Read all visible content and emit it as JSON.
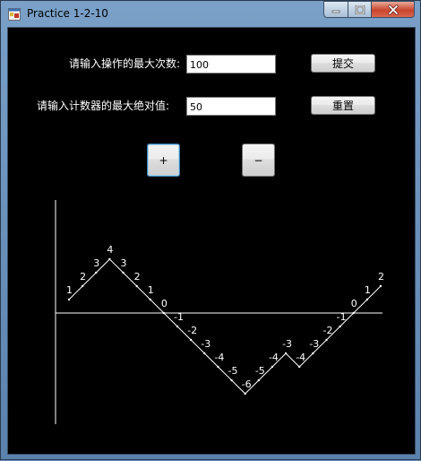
{
  "window": {
    "title": "Practice 1-2-10"
  },
  "form": {
    "max_ops_label": "请输入操作的最大次数:",
    "max_ops_value": "100",
    "max_abs_label": "请输入计数器的最大绝对值:",
    "max_abs_value": "50",
    "submit_label": "提交",
    "reset_label": "重置",
    "plus_label": "+",
    "minus_label": "−"
  },
  "graph": {
    "counter_values": [
      1,
      2,
      3,
      4,
      3,
      2,
      1,
      0,
      -1,
      -2,
      -3,
      -4,
      -5,
      -6,
      -5,
      -4,
      -3,
      -4,
      -3,
      -2,
      -1,
      0,
      1,
      2
    ]
  },
  "colors": {
    "background": "#000000",
    "line": "#ffffff",
    "text": "#ffffff"
  }
}
